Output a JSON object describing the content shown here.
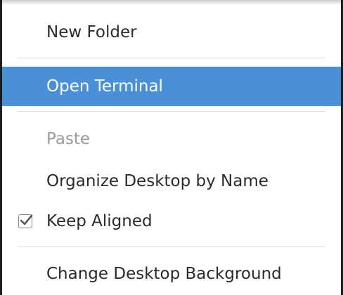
{
  "menu": {
    "items": [
      {
        "label": "New Folder",
        "state": "normal"
      },
      {
        "label": "Open Terminal",
        "state": "highlighted"
      },
      {
        "label": "Paste",
        "state": "disabled"
      },
      {
        "label": "Organize Desktop by Name",
        "state": "normal"
      },
      {
        "label": "Keep Aligned",
        "state": "checked"
      },
      {
        "label": "Change Desktop Background",
        "state": "normal"
      }
    ],
    "colors": {
      "highlight": "#4a90d9",
      "highlight_text": "#ffffff",
      "text": "#2b2b2b",
      "disabled_text": "#9b9b9b",
      "separator": "#dcdcdc"
    },
    "icons": {
      "keep_aligned": "checkbox-checked-icon"
    }
  }
}
